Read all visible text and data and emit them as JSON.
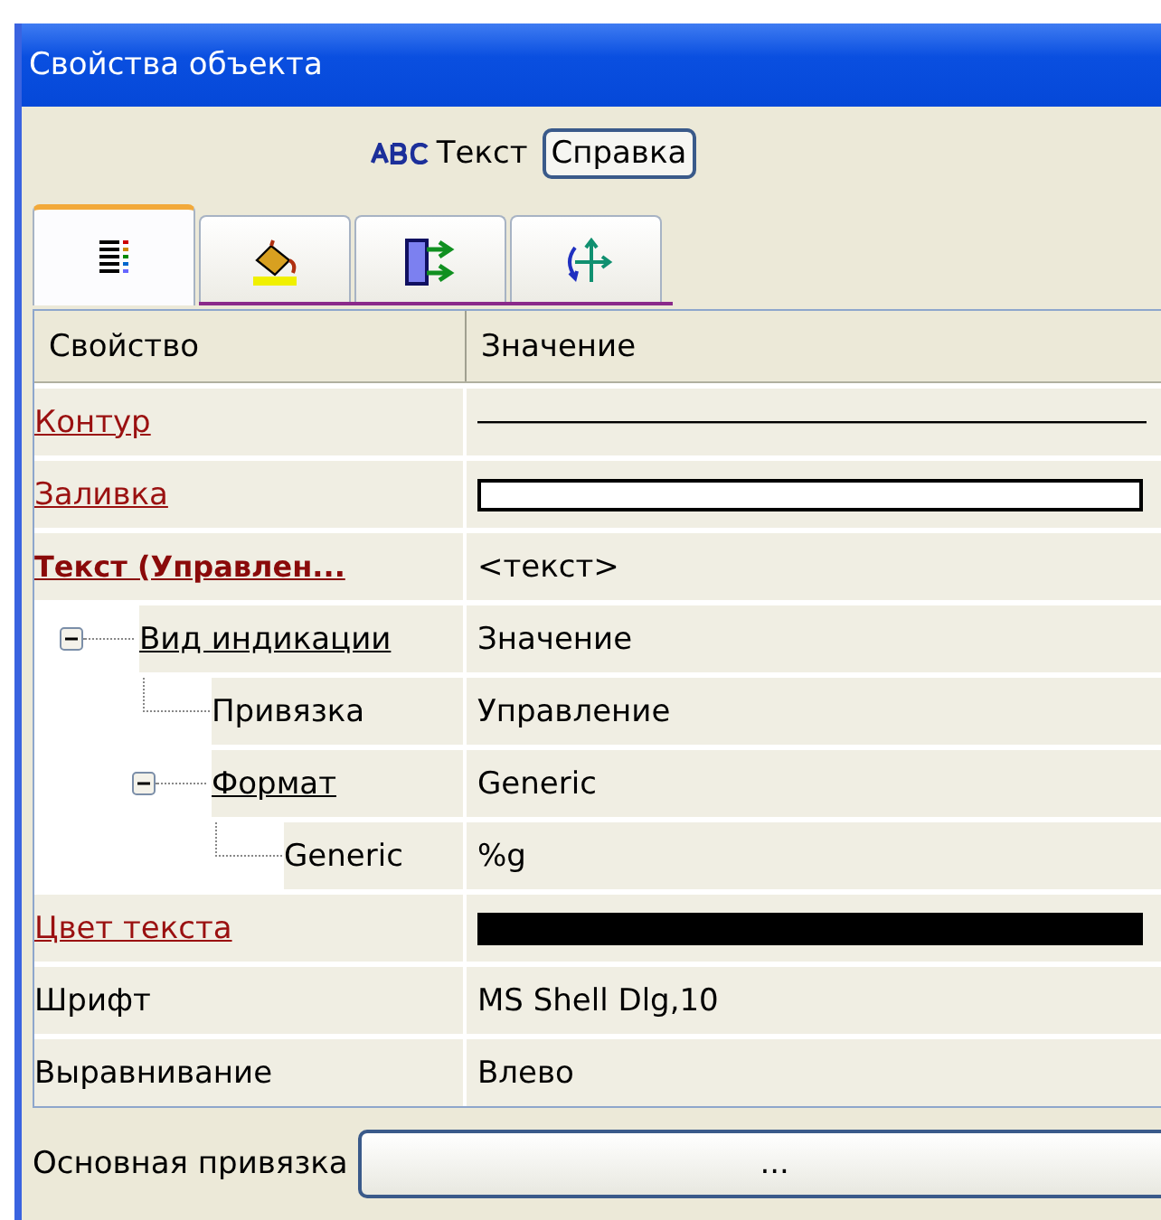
{
  "window": {
    "title": "Свойства объекта"
  },
  "object": {
    "type_label": "Текст",
    "help_button": "Справка"
  },
  "tabs": [
    {
      "kind": "list",
      "selected": true
    },
    {
      "kind": "fill",
      "selected": false
    },
    {
      "kind": "links",
      "selected": false
    },
    {
      "kind": "move",
      "selected": false
    }
  ],
  "table": {
    "columns": [
      "Свойство",
      "Значение"
    ],
    "rows": [
      {
        "name": "Контур",
        "kind": "link"
      },
      {
        "name": "Заливка",
        "kind": "link",
        "color": "#ffffff"
      },
      {
        "name": "Текст (Управлен...",
        "kind": "bold_link",
        "value": "<текст>"
      },
      {
        "name": "Вид индикации",
        "kind": "dark_link",
        "value": "Значение",
        "expanded": true,
        "children": [
          {
            "name": "Привязка",
            "kind": "plain",
            "value": "Управление"
          },
          {
            "name": "Формат",
            "kind": "dark_link",
            "value": "Generic",
            "expanded": true,
            "children": [
              {
                "name": "Generic",
                "kind": "plain",
                "value": "%g"
              }
            ]
          }
        ]
      },
      {
        "name": "Цвет текста",
        "kind": "link",
        "color": "#000000"
      },
      {
        "name": "Шрифт",
        "kind": "plain",
        "value": "MS Shell Dlg,10"
      },
      {
        "name": "Выравнивание",
        "kind": "plain",
        "value": "Влево"
      }
    ]
  },
  "binding": {
    "label": "Основная привязка",
    "button": "..."
  }
}
